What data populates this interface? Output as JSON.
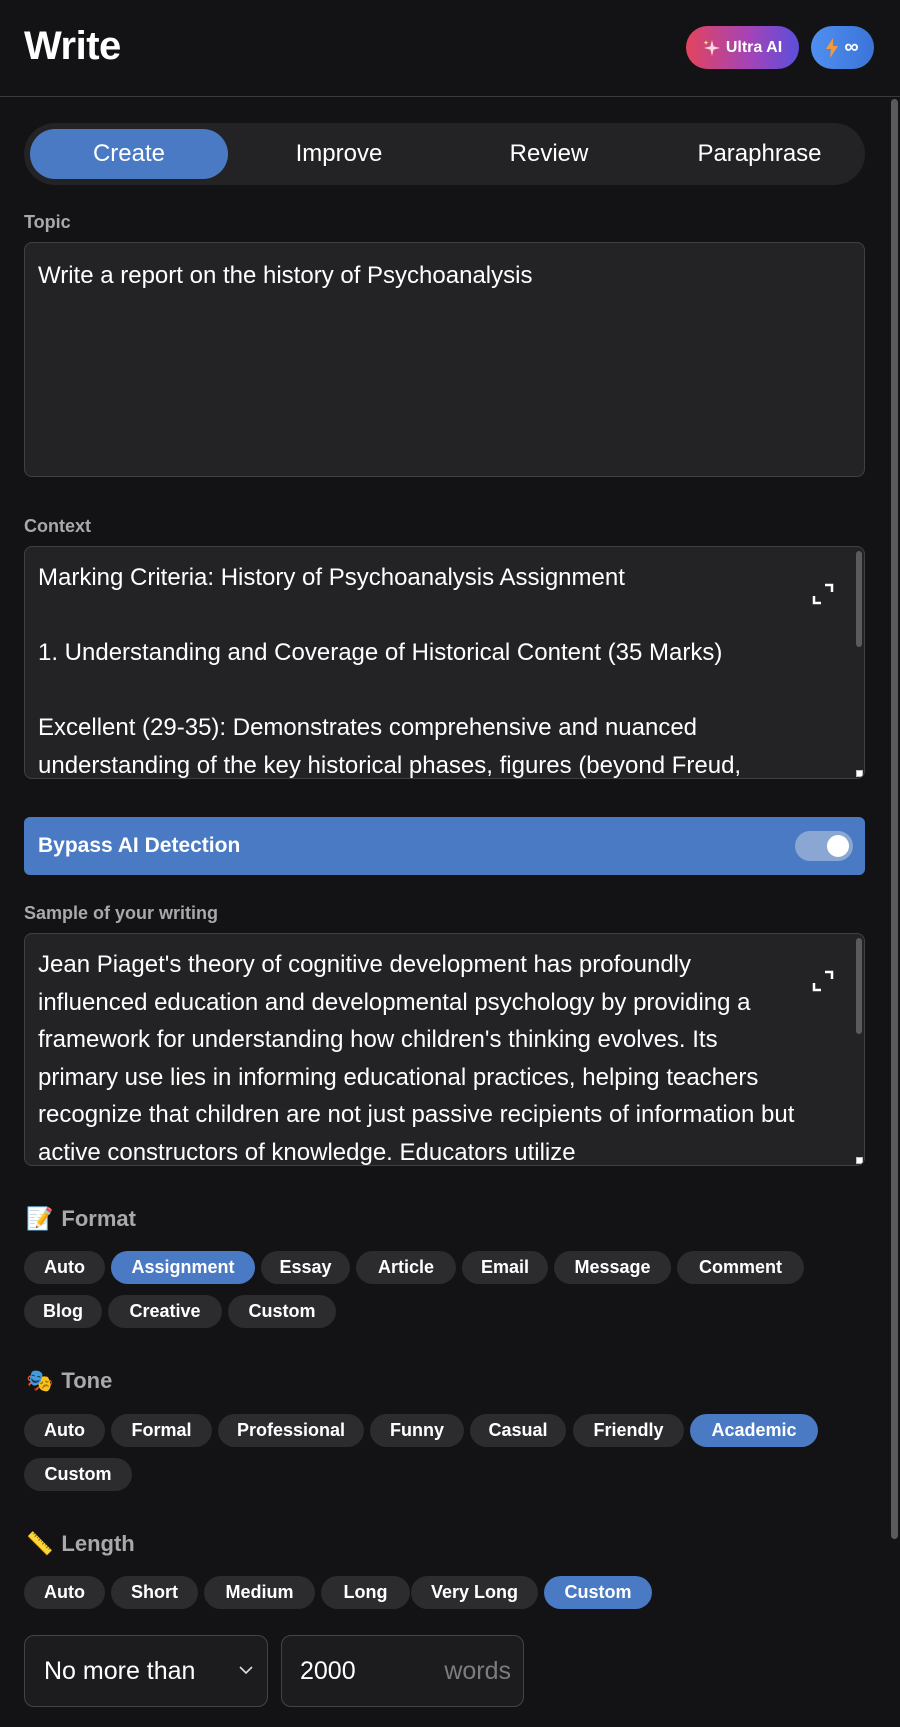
{
  "header": {
    "title": "Write",
    "ultra_label": "Ultra AI",
    "infinity": "∞"
  },
  "tabs": [
    {
      "label": "Create",
      "active": true
    },
    {
      "label": "Improve",
      "active": false
    },
    {
      "label": "Review",
      "active": false
    },
    {
      "label": "Paraphrase",
      "active": false
    }
  ],
  "topic": {
    "label": "Topic",
    "value": "Write a report on the history of Psychoanalysis"
  },
  "context": {
    "label": "Context",
    "value": "Marking Criteria: History of Psychoanalysis Assignment\n\n1. Understanding and Coverage of Historical Content (35 Marks)\n\nExcellent (29-35): Demonstrates comprehensive and nuanced understanding of the key historical phases, figures (beyond Freud,"
  },
  "bypass": {
    "label": "Bypass AI Detection",
    "enabled": true
  },
  "sample": {
    "label": "Sample of your writing",
    "value": "Jean Piaget's theory of cognitive development has profoundly influenced education and developmental psychology by providing a framework for understanding how children's thinking evolves. Its primary use lies in informing educational practices, helping teachers recognize that children are not just passive recipients of information but active constructors of knowledge. Educators utilize"
  },
  "format": {
    "title": "Format",
    "emoji": "📝",
    "chips": [
      "Auto",
      "Assignment",
      "Essay",
      "Article",
      "Email",
      "Message",
      "Comment",
      "Blog",
      "Creative",
      "Custom"
    ],
    "selected": "Assignment"
  },
  "tone": {
    "title": "Tone",
    "emoji": "🎭",
    "chips": [
      "Auto",
      "Formal",
      "Professional",
      "Funny",
      "Casual",
      "Friendly",
      "Academic",
      "Custom"
    ],
    "selected": "Academic"
  },
  "length": {
    "title": "Length",
    "emoji": "📏",
    "chips": [
      "Auto",
      "Short",
      "Medium",
      "Long",
      "Very Long",
      "Custom"
    ],
    "selected": "Custom"
  },
  "limit": {
    "mode": "No more than",
    "value": "2000",
    "unit": "words"
  },
  "colors": {
    "accent": "#4a7ac3",
    "chip": "#2c2c2f",
    "background": "#131315"
  }
}
